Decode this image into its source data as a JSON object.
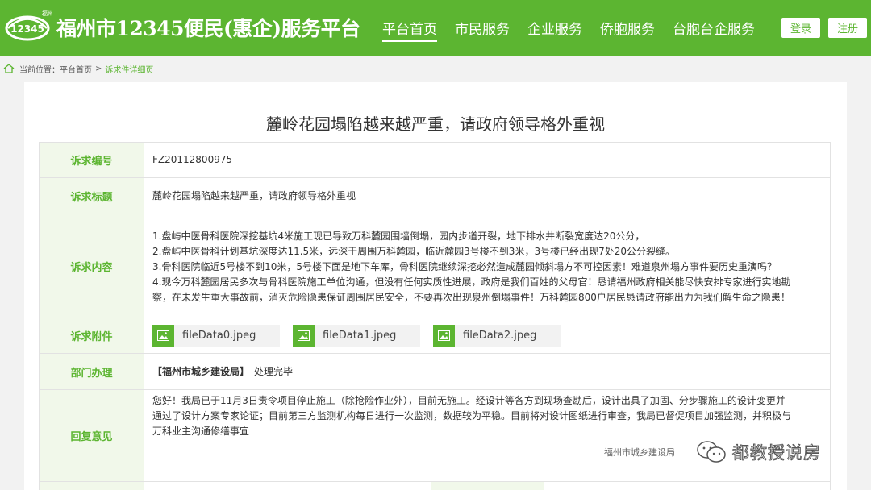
{
  "header": {
    "logo_text": "福州",
    "logo_number": "12345",
    "site_title": "福州市12345便民(惠企)服务平台",
    "nav": [
      {
        "label": "平台首页",
        "active": true
      },
      {
        "label": "市民服务",
        "active": false
      },
      {
        "label": "企业服务",
        "active": false
      },
      {
        "label": "侨胞服务",
        "active": false
      },
      {
        "label": "台胞台企服务",
        "active": false
      }
    ],
    "login_label": "登录",
    "register_label": "注册"
  },
  "breadcrumb": {
    "prefix": "当前位置：",
    "home": "平台首页",
    "separator": ">",
    "current": "诉求件详细页"
  },
  "page_title": "麓岭花园塌陷越来越严重，请政府领导格外重视",
  "detail": {
    "id_label": "诉求编号",
    "id_value": "FZ20112800975",
    "title_label": "诉求标题",
    "title_value": "麓岭花园塌陷越来越严重，请政府领导格外重视",
    "content_label": "诉求内容",
    "content_lines": [
      "1.盘屿中医骨科医院深挖基坑4米施工现已导致万科麓园围墙倒塌，园内步道开裂，地下排水井断裂宽度达20公分，",
      "2.盘屿中医骨科计划基坑深度达11.5米，远深于周围万科麓园，临近麓园3号楼不到3米，3号楼已经出现7处20公分裂缝。",
      "3.骨科医院临近5号楼不到10米，5号楼下面是地下车库，骨科医院继续深挖必然造成麓园倾斜塌方不可控因素！难道泉州塌方事件要历史重演吗？",
      "4.现今万科麓园居民多次与骨科医院施工单位沟通，但没有任何实质性进展，政府是我们百姓的父母官！恳请福州政府相关能尽快安排专家进行实地勘",
      "察，在未发生重大事故前，消灭危险隐患保证周围居民安全，不要再次出现泉州倒塌事件！万科麓园800户居民恳请政府能出力为我们解生命之隐患！"
    ],
    "attach_label": "诉求附件",
    "attachments": [
      "fileData0.jpeg",
      "fileData1.jpeg",
      "fileData2.jpeg"
    ],
    "dept_label": "部门办理",
    "dept_name": "【福州市城乡建设局】",
    "dept_status": "处理完毕",
    "reply_label": "回复意见",
    "reply_lines": [
      "您好！我局已于11月3日责令项目停止施工（除抢险作业外），目前无施工。经设计等各方到现场查勘后，设计出具了加固、分步骤施工的设计变更并",
      "通过了设计方案专家论证；目前第三方监测机构每日进行一次监测，数据较为平稳。目前将对设计图纸进行审查，我局已督促项目加强监测，并积极与",
      "万科业主沟通修缮事宜"
    ],
    "reply_signature": "福州市城乡建设局"
  },
  "watermark": {
    "text": "都教授说房"
  },
  "colors": {
    "brand_green": "#5cb531",
    "label_bg": "#f1f8ea"
  }
}
